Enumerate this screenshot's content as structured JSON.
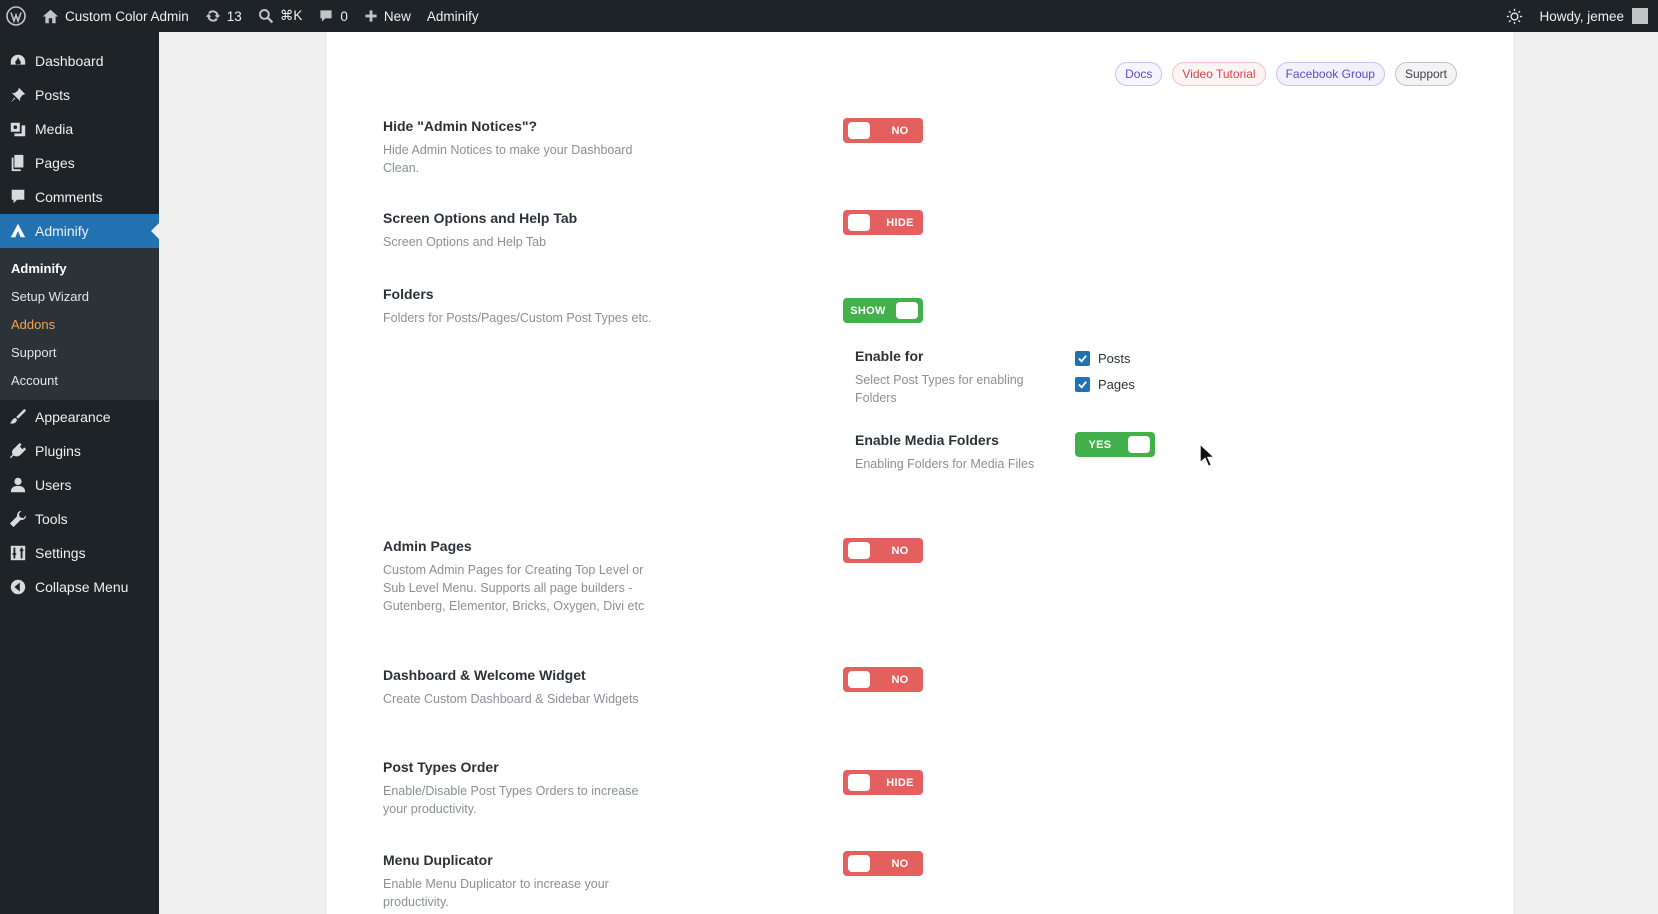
{
  "adminbar": {
    "site_name": "Custom Color Admin",
    "updates_count": "13",
    "search_shortcut": "⌘K",
    "comments_count": "0",
    "new_label": "New",
    "plugin_label": "Adminify",
    "greeting": "Howdy, jemee"
  },
  "sidebar": {
    "items_top": [
      {
        "label": "Dashboard",
        "icon": "dashboard-icon"
      },
      {
        "label": "Posts",
        "icon": "pin-icon"
      },
      {
        "label": "Media",
        "icon": "media-icon"
      },
      {
        "label": "Pages",
        "icon": "pages-icon"
      },
      {
        "label": "Comments",
        "icon": "comment-icon"
      },
      {
        "label": "Adminify",
        "icon": "adminify-icon"
      }
    ],
    "submenu": [
      {
        "label": "Adminify"
      },
      {
        "label": "Setup Wizard"
      },
      {
        "label": "Addons"
      },
      {
        "label": "Support"
      },
      {
        "label": "Account"
      }
    ],
    "items_bottom": [
      {
        "label": "Appearance",
        "icon": "brush-icon"
      },
      {
        "label": "Plugins",
        "icon": "plugin-icon"
      },
      {
        "label": "Users",
        "icon": "user-icon"
      },
      {
        "label": "Tools",
        "icon": "wrench-icon"
      },
      {
        "label": "Settings",
        "icon": "settings-icon"
      },
      {
        "label": "Collapse Menu",
        "icon": "collapse-icon"
      }
    ]
  },
  "links": {
    "docs": "Docs",
    "video": "Video Tutorial",
    "facebook": "Facebook Group",
    "support": "Support"
  },
  "settings": [
    {
      "title": "Hide \"Admin Notices\"?",
      "desc": "Hide Admin Notices to make your Dashboard Clean.",
      "toggle": "NO"
    },
    {
      "title": "Screen Options and Help Tab",
      "desc": "Screen Options and Help Tab",
      "toggle": "HIDE"
    },
    {
      "title": "Folders",
      "desc": "Folders for Posts/Pages/Custom Post Types etc.",
      "toggle": "SHOW"
    },
    {
      "title": "Admin Pages",
      "desc": "Custom Admin Pages for Creating Top Level or Sub Level Menu. Supports all page builders - Gutenberg, Elementor, Bricks, Oxygen, Divi etc",
      "toggle": "NO"
    },
    {
      "title": "Dashboard & Welcome Widget",
      "desc": "Create Custom Dashboard & Sidebar Widgets",
      "toggle": "NO"
    },
    {
      "title": "Post Types Order",
      "desc": "Enable/Disable Post Types Orders to increase your productivity.",
      "toggle": "HIDE"
    },
    {
      "title": "Menu Duplicator",
      "desc": "Enable Menu Duplicator to increase your productivity.",
      "toggle": "NO"
    }
  ],
  "folders": {
    "enable_for": {
      "title": "Enable for",
      "desc": "Select Post Types for enabling Folders"
    },
    "options": [
      {
        "label": "Posts",
        "checked": true
      },
      {
        "label": "Pages",
        "checked": true
      }
    ],
    "media": {
      "title": "Enable Media Folders",
      "desc": "Enabling Folders for Media Files",
      "toggle": "YES"
    }
  },
  "colors": {
    "toggle_off": "#e3605f",
    "toggle_on": "#43b14b",
    "active_menu": "#2271b1"
  }
}
